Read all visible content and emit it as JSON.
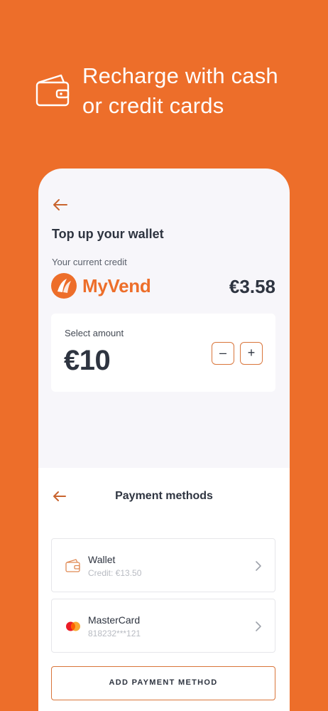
{
  "promo": {
    "line1": "Recharge with cash",
    "line2": "or credit cards",
    "icon": "wallet-icon"
  },
  "screen": {
    "back_icon": "arrow-left-icon",
    "title": "Top up your wallet",
    "credit_label": "Your current credit",
    "brand_name": "MyVend",
    "credit_amount": "€3.58",
    "amount_card": {
      "label": "Select amount",
      "value": "€10",
      "minus": "–",
      "plus": "+"
    }
  },
  "payment_sheet": {
    "title": "Payment methods",
    "methods": [
      {
        "name": "Wallet",
        "detail": "Credit: €13.50",
        "icon": "wallet-icon"
      },
      {
        "name": "MasterCard",
        "detail": "818232***121",
        "icon": "mastercard-icon"
      }
    ],
    "add_button": "ADD PAYMENT METHOD"
  },
  "colors": {
    "brand": "#ED6E2A",
    "accent_border": "#D9753A",
    "text_dark": "#2E3440",
    "screen_bg": "#F7F6FA"
  }
}
